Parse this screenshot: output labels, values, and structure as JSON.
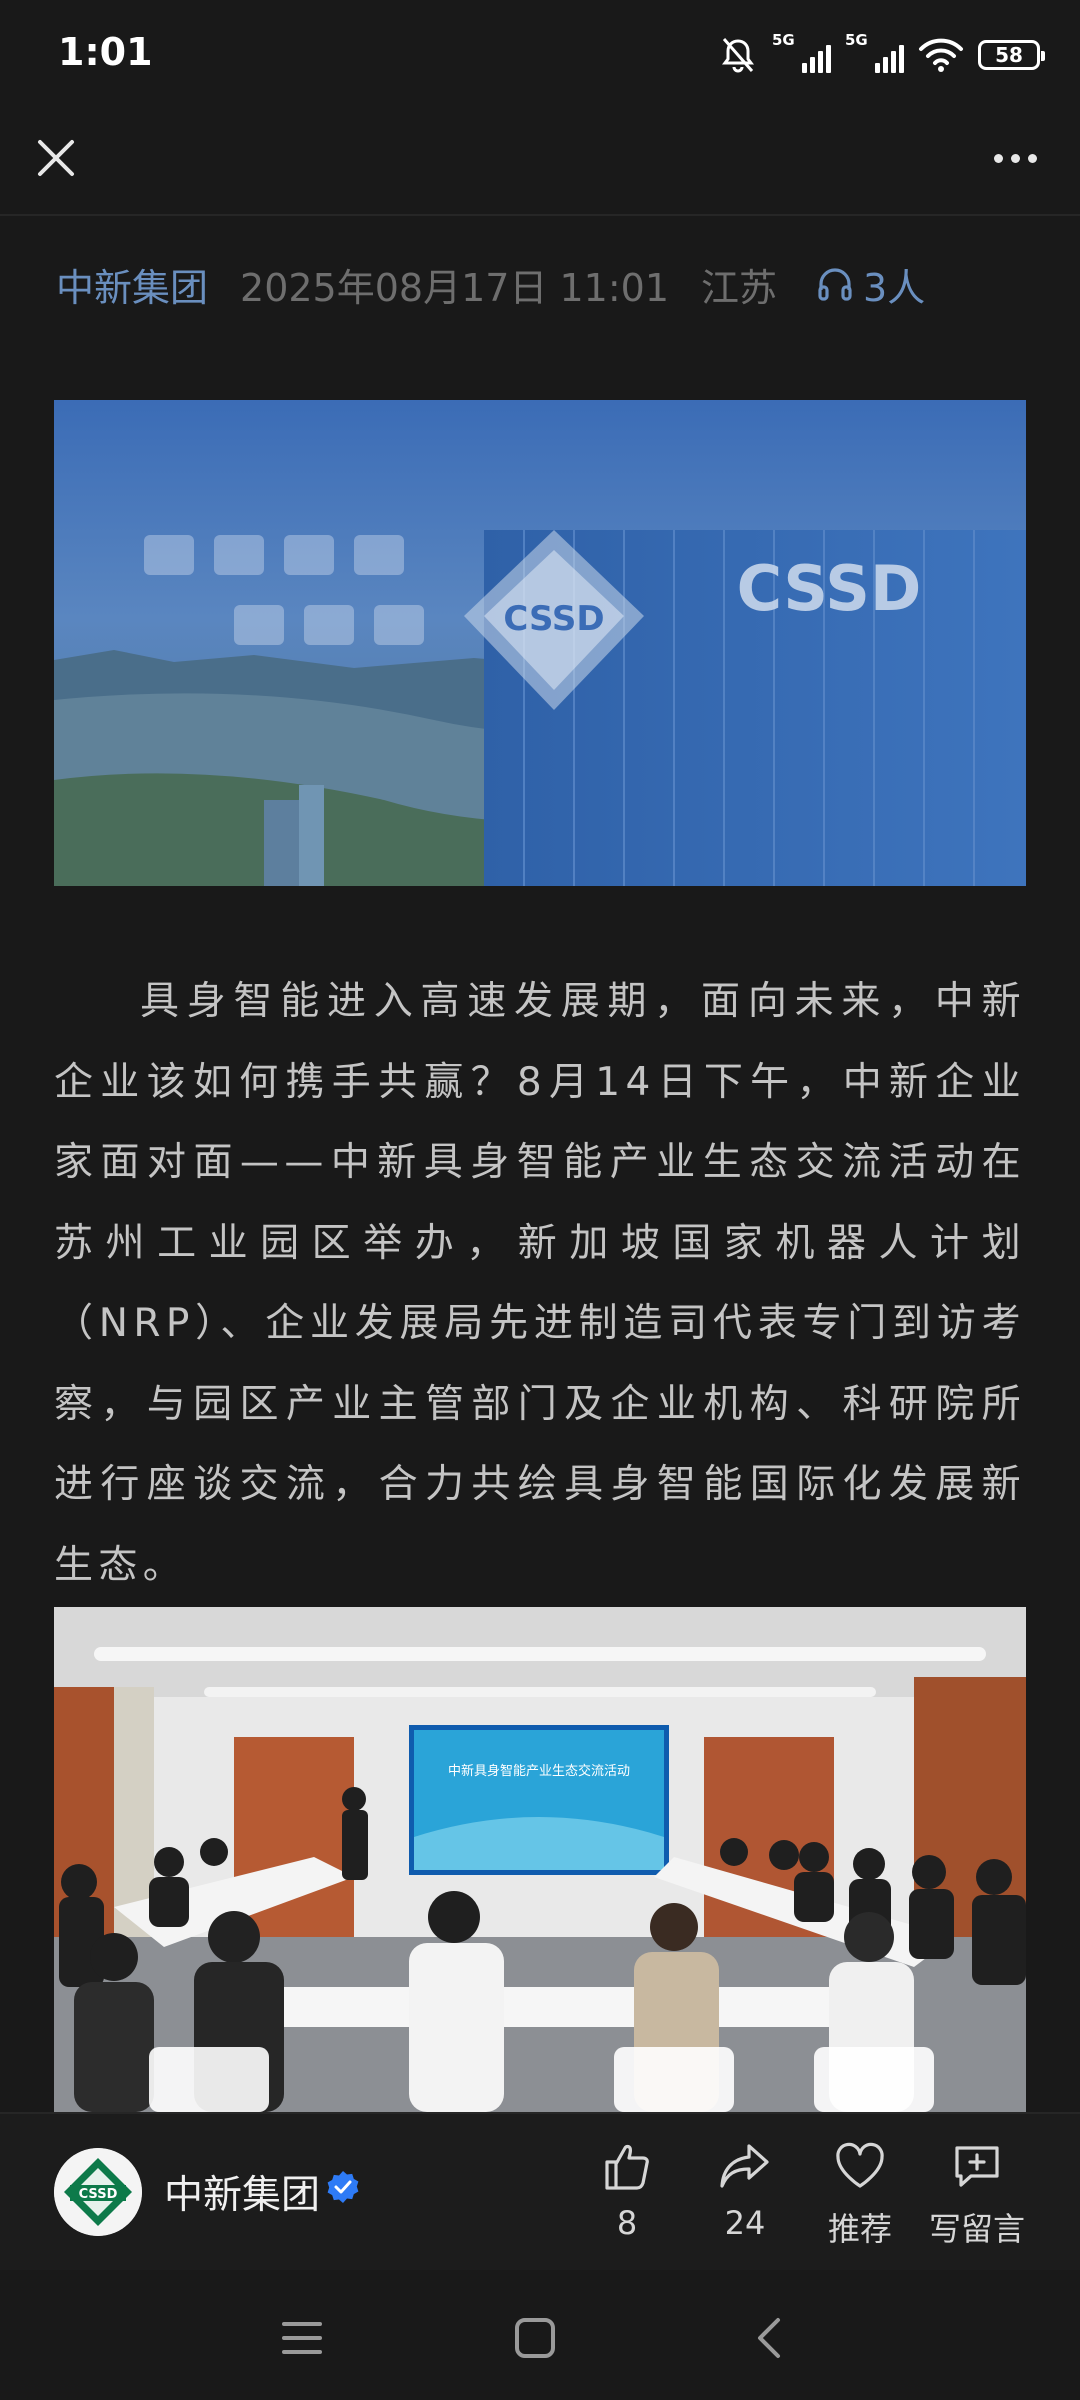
{
  "status_bar": {
    "time": "1:01",
    "signal1": "5G",
    "signal2": "5G",
    "battery": "58",
    "icons": [
      "mute-bell-icon",
      "signal-icon",
      "signal-icon",
      "wifi-icon",
      "battery-icon"
    ]
  },
  "nav": {
    "close_icon": "close-icon",
    "more_icon": "more-icon"
  },
  "meta": {
    "author": "中新集团",
    "date": "2025年08月17日 11:01",
    "location": "江苏",
    "listeners": "3人",
    "listen_icon": "headphones-icon"
  },
  "banner": {
    "logo_text": "CSSD",
    "tower_text": "CSSD"
  },
  "article": {
    "paragraph": "具身智能进入高速发展期，面向未来，中新企业该如何携手共赢？8月14日下午，中新企业家面对面——中新具身智能产业生态交流活动在苏州工业园区举办，新加坡国家机器人计划（NRP）、企业发展局先进制造司代表专门到访考察，与园区产业主管部门及企业机构、科研院所进行座谈交流，合力共绘具身智能国际化发展新生态。"
  },
  "meeting_photo": {
    "screen_title": "中新具身智能产业生态交流活动"
  },
  "bottom_bar": {
    "account_name": "中新集团",
    "avatar_text": "CSSD",
    "like_count": "8",
    "share_count": "24",
    "recommend_label": "推荐",
    "comment_label": "写留言"
  },
  "colors": {
    "background": "#191919",
    "link": "#6a8fbf",
    "muted": "#6e6e6e",
    "verified": "#2e7bf6",
    "brand_green": "#0d7a4a"
  }
}
